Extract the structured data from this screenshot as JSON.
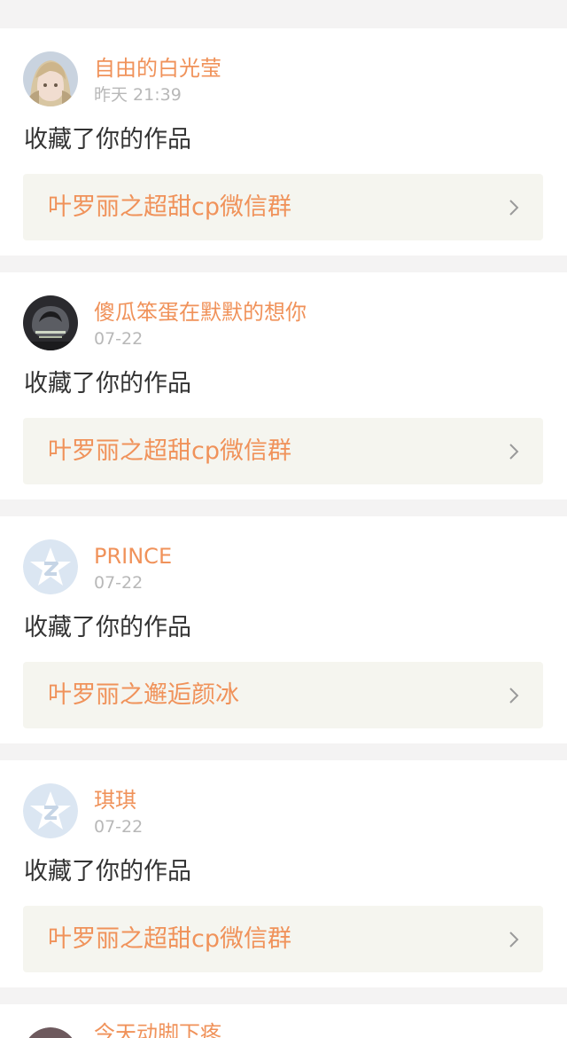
{
  "notifications": [
    {
      "username": "自由的白光莹",
      "time": "昨天 21:39",
      "action": "收藏了你的作品",
      "work_title": "叶罗丽之超甜cp微信群",
      "avatar": "anime-girl-avatar"
    },
    {
      "username": "傻瓜笨蛋在默默的想你",
      "time": "07-22",
      "action": "收藏了你的作品",
      "work_title": "叶罗丽之超甜cp微信群",
      "avatar": "dark-photo-avatar"
    },
    {
      "username": "PRINCE",
      "time": "07-22",
      "action": "收藏了你的作品",
      "work_title": "叶罗丽之邂逅颜冰",
      "avatar": "default-star-avatar"
    },
    {
      "username": "琪琪",
      "time": "07-22",
      "action": "收藏了你的作品",
      "work_title": "叶罗丽之超甜cp微信群",
      "avatar": "default-star-avatar"
    }
  ],
  "partial_item": {
    "username": "今天动脚下疼"
  },
  "colors": {
    "accent": "#f0925a",
    "timestamp": "#b8b8b8",
    "text": "#333333",
    "link_bg": "#f5f5ef",
    "page_bg": "#f4f3f3",
    "default_avatar": "#dbe6f2"
  }
}
